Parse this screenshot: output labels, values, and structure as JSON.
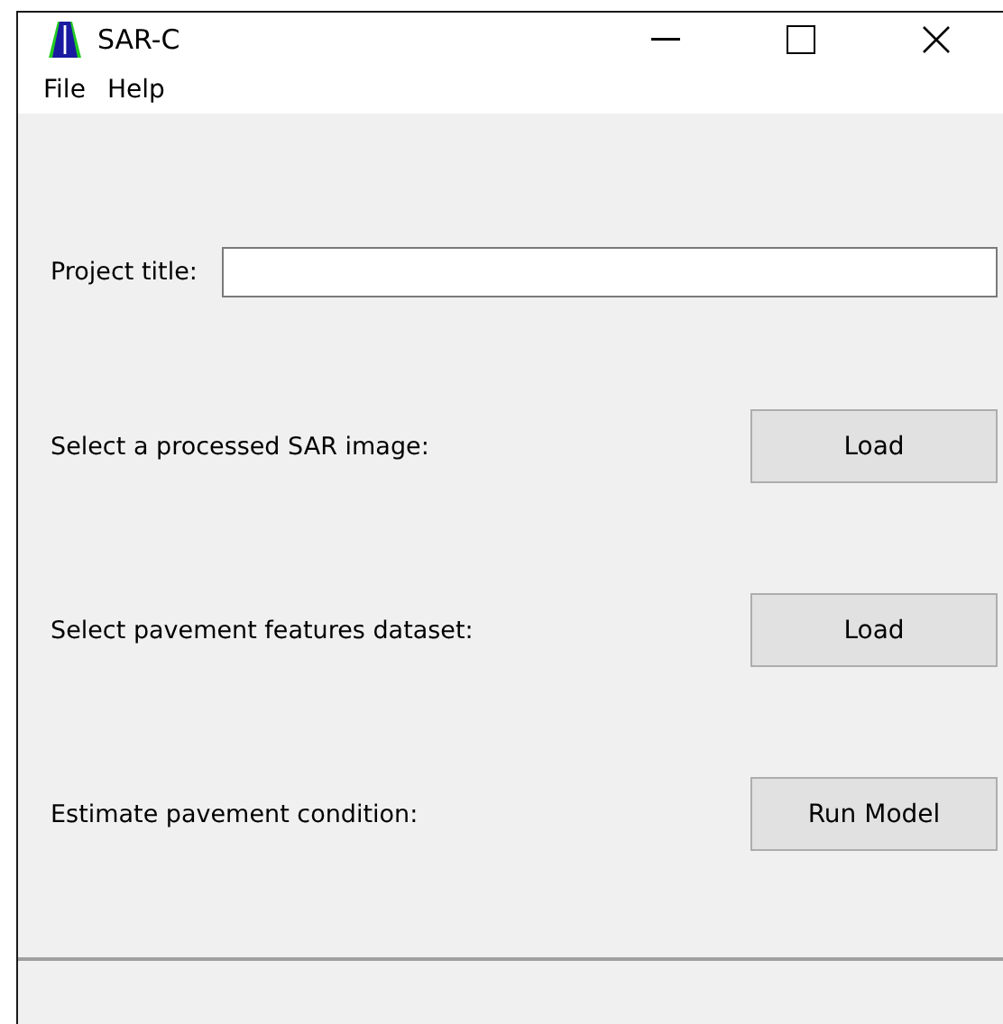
{
  "window": {
    "title": "SAR-C"
  },
  "menu": [
    {
      "label": "File"
    },
    {
      "label": "Help"
    }
  ],
  "project": {
    "label": "Project title:"
  },
  "actions": [
    {
      "label": "Select a processed SAR image:",
      "button": "Load"
    },
    {
      "label": "Select pavement features dataset:",
      "button": "Load"
    },
    {
      "label": "Estimate pavement condition:",
      "button": "Run Model"
    }
  ]
}
